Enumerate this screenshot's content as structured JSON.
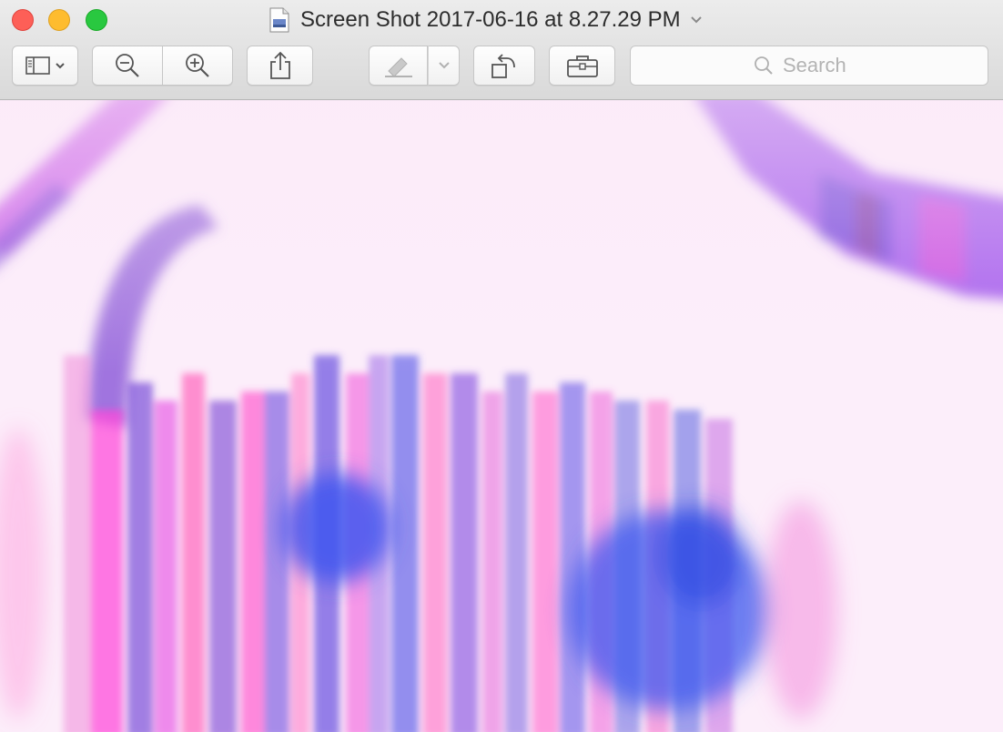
{
  "window": {
    "title": "Screen Shot 2017-06-16 at 8.27.29 PM"
  },
  "toolbar": {
    "sidebar_icon": "sidebar-icon",
    "zoom_out_icon": "zoom-out-icon",
    "zoom_in_icon": "zoom-in-icon",
    "share_icon": "share-icon",
    "markup_icon": "markup-pen-icon",
    "rotate_icon": "rotate-left-icon",
    "toolbox_icon": "toolbox-icon"
  },
  "search": {
    "placeholder": "Search",
    "value": ""
  },
  "colors": {
    "close": "#fd5f57",
    "minimize": "#febc2e",
    "maximize": "#29c840",
    "image_background": "#fbe9f8",
    "image_magenta": "#ee44ee",
    "image_blue": "#4a5af0",
    "image_purple": "#9a4ef0"
  }
}
